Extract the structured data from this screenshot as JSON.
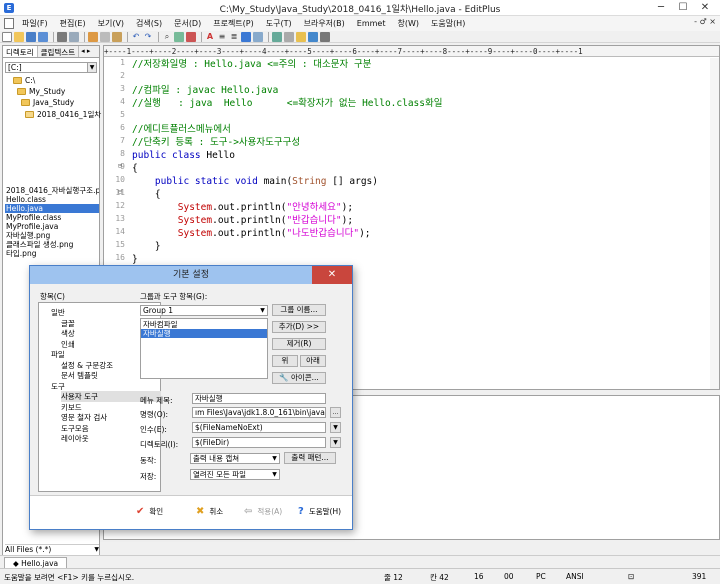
{
  "window": {
    "title": "C:\\My_Study\\Java_Study\\2018_0416_1일차\\Hello.java - EditPlus",
    "controls": [
      "─",
      "☐",
      "✕"
    ]
  },
  "menu": [
    "파일(F)",
    "편집(E)",
    "보기(V)",
    "검색(S)",
    "문서(D)",
    "프로젝트(P)",
    "도구(T)",
    "브라우저(B)",
    "Emmet",
    "창(W)",
    "도움말(H)"
  ],
  "menu_right": "- ♂ ×",
  "left_panel": {
    "tabs": [
      "디렉토리",
      "클립텍스트"
    ],
    "tab_arrows": "◂ ▸",
    "drive": "[C:]",
    "dirs": [
      "C:\\",
      "My_Study",
      "Java_Study",
      "2018_0416_1일차"
    ],
    "files": [
      "2018_0416_자바실행구조.png",
      "Hello.class",
      "Hello.java",
      "MyProfile.class",
      "MyProfile.java",
      "자바실행.png",
      "클래스파일 생성.png",
      "타입.png"
    ],
    "selected_file": 2,
    "filter": "All Files (*.*)"
  },
  "editor": {
    "ruler": "+----1----+----2----+----3----+----4----+----5----+----6----+----7----+----8----+----9----+----0----+----1",
    "lines": [
      {
        "n": "1",
        "fold": "",
        "segs": [
          {
            "c": "cmt",
            "t": "//저장화일명 : Hello.java <=주의 : 대소문자 구분"
          }
        ]
      },
      {
        "n": "2",
        "fold": "",
        "segs": []
      },
      {
        "n": "3",
        "fold": "",
        "segs": [
          {
            "c": "cmt",
            "t": "//컴파일 : javac Hello.java"
          }
        ]
      },
      {
        "n": "4",
        "fold": "",
        "segs": [
          {
            "c": "cmt",
            "t": "//실행   : java  Hello      <=확장자가 없는 Hello.class화일"
          }
        ]
      },
      {
        "n": "5",
        "fold": "",
        "segs": []
      },
      {
        "n": "6",
        "fold": "",
        "segs": [
          {
            "c": "cmt",
            "t": "//에디트플러스메뉴에서"
          }
        ]
      },
      {
        "n": "7",
        "fold": "",
        "segs": [
          {
            "c": "cmt",
            "t": "//단축키 등록 : 도구->사용자도구구성"
          }
        ]
      },
      {
        "n": "8",
        "fold": "",
        "segs": [
          {
            "c": "kw",
            "t": "public class "
          },
          {
            "c": "plain",
            "t": "Hello"
          }
        ]
      },
      {
        "n": "9",
        "fold": "⊟",
        "segs": [
          {
            "c": "plain",
            "t": "{"
          }
        ]
      },
      {
        "n": "10",
        "fold": "",
        "segs": [
          {
            "c": "plain",
            "t": "    "
          },
          {
            "c": "kw",
            "t": "public static void "
          },
          {
            "c": "plain",
            "t": "main("
          },
          {
            "c": "brown",
            "t": "String"
          },
          {
            "c": "plain",
            "t": " [] args)"
          }
        ]
      },
      {
        "n": "11",
        "fold": "⊟",
        "segs": [
          {
            "c": "plain",
            "t": "    {"
          }
        ]
      },
      {
        "n": "12",
        "fold": "",
        "segs": [
          {
            "c": "plain",
            "t": "        "
          },
          {
            "c": "red",
            "t": "System"
          },
          {
            "c": "plain",
            "t": ".out.println("
          },
          {
            "c": "str",
            "t": "\"안녕하세요\""
          },
          {
            "c": "plain",
            "t": ");"
          }
        ]
      },
      {
        "n": "13",
        "fold": "",
        "segs": [
          {
            "c": "plain",
            "t": "        "
          },
          {
            "c": "red",
            "t": "System"
          },
          {
            "c": "plain",
            "t": ".out.println("
          },
          {
            "c": "str",
            "t": "\"반갑습니다\""
          },
          {
            "c": "plain",
            "t": ");"
          }
        ]
      },
      {
        "n": "14",
        "fold": "",
        "segs": [
          {
            "c": "plain",
            "t": "        "
          },
          {
            "c": "red",
            "t": "System"
          },
          {
            "c": "plain",
            "t": ".out.println("
          },
          {
            "c": "str",
            "t": "\"나도반갑습니다\""
          },
          {
            "c": "plain",
            "t": ");"
          }
        ]
      },
      {
        "n": "15",
        "fold": "",
        "segs": [
          {
            "c": "plain",
            "t": "    }"
          }
        ]
      },
      {
        "n": "16",
        "fold": "",
        "segs": [
          {
            "c": "plain",
            "t": "}"
          }
        ]
      }
    ]
  },
  "dialog": {
    "title": "기본 설정",
    "close": "✕",
    "category_label": "항목(C)",
    "categories": [
      {
        "t": "일반",
        "indent": 1
      },
      {
        "t": "글꼴",
        "indent": 2
      },
      {
        "t": "색상",
        "indent": 2
      },
      {
        "t": "인쇄",
        "indent": 2
      },
      {
        "t": "파일",
        "indent": 1
      },
      {
        "t": "설정 & 구문강조",
        "indent": 2
      },
      {
        "t": "문서 템플릿",
        "indent": 2
      },
      {
        "t": "도구",
        "indent": 1
      },
      {
        "t": "사용자 도구",
        "indent": 2,
        "sel": true
      },
      {
        "t": "키보드",
        "indent": 2
      },
      {
        "t": "영문 철자 검사",
        "indent": 2
      },
      {
        "t": "도구모음",
        "indent": 2
      },
      {
        "t": "레이아웃",
        "indent": 2
      }
    ],
    "group_label": "그룹과 도구 항목(G):",
    "group_value": "Group 1",
    "tools": [
      "자바컴파일",
      "자바실행"
    ],
    "selected_tool": 1,
    "buttons": {
      "group_name": "그룹 이름...",
      "add": "추가(D) >>",
      "remove": "제거(R)",
      "up": "위",
      "down": "아래",
      "icon": "아이콘..."
    },
    "fields": {
      "menu_title_label": "메뉴 제목:",
      "menu_title_value": "자바실행",
      "command_label": "명령(O):",
      "command_value": "ım Files\\Java\\jdk1.8.0_161\\bin\\java.exe",
      "args_label": "인수(E):",
      "args_value": "$(FileNameNoExt)",
      "dir_label": "디렉토리(I):",
      "dir_value": "$(FileDir)",
      "action_label": "동작:",
      "action_value": "출력 내용 캡쳐",
      "output_pattern": "출력 패턴...",
      "save_label": "저장:",
      "save_value": "열려진 모든 파일",
      "browse": "..."
    },
    "footer": {
      "ok": "확인",
      "cancel": "취소",
      "apply": "적용(A)",
      "help": "도움말(H)"
    }
  },
  "doc_tab": "Hello.java",
  "status": {
    "message": "도움말을 보려면 <F1> 키를 누르십시오.",
    "line": "줄 12",
    "col": "칸 42",
    "sel_a": "16",
    "sel_b": "00",
    "mode": "PC",
    "encoding": "ANSI",
    "size": "391"
  }
}
